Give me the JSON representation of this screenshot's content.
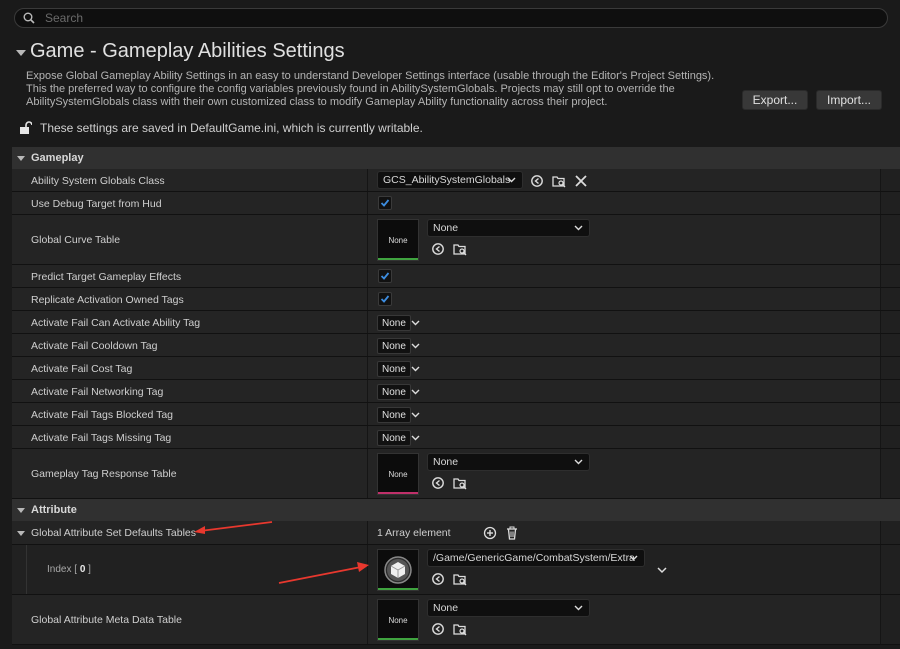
{
  "search": {
    "placeholder": "Search"
  },
  "header": {
    "title": "Game - Gameplay Abilities Settings",
    "description": [
      "Expose Global Gameplay Ability Settings in an easy to understand Developer Settings interface (usable through the Editor's Project Settings).",
      "This the preferred way to configure the config variables previously found in AbilitySystemGlobals.  Projects may still opt to override the",
      "AbilitySystemGlobals class with their own customized class to modify Gameplay Ability functionality across their project."
    ],
    "export_label": "Export...",
    "import_label": "Import...",
    "writable_text": "These settings are saved in DefaultGame.ini, which is currently writable."
  },
  "categories": {
    "gameplay": "Gameplay",
    "attribute": "Attribute"
  },
  "gameplay": {
    "ability_system_globals_class": {
      "label": "Ability System Globals Class",
      "value": "GCS_AbilitySystemGlobals"
    },
    "use_debug_target": {
      "label": "Use Debug Target from Hud",
      "checked": true
    },
    "global_curve_table": {
      "label": "Global Curve Table",
      "thumb": "None",
      "value": "None"
    },
    "predict_target_effects": {
      "label": "Predict Target Gameplay Effects",
      "checked": true
    },
    "replicate_activation_tags": {
      "label": "Replicate Activation Owned Tags",
      "checked": true
    },
    "fail_can_activate": {
      "label": "Activate Fail Can Activate Ability Tag",
      "value": "None"
    },
    "fail_cooldown": {
      "label": "Activate Fail Cooldown Tag",
      "value": "None"
    },
    "fail_cost": {
      "label": "Activate Fail Cost Tag",
      "value": "None"
    },
    "fail_networking": {
      "label": "Activate Fail Networking Tag",
      "value": "None"
    },
    "fail_tags_blocked": {
      "label": "Activate Fail Tags Blocked Tag",
      "value": "None"
    },
    "fail_tags_missing": {
      "label": "Activate Fail Tags Missing Tag",
      "value": "None"
    },
    "tag_response_table": {
      "label": "Gameplay Tag Response Table",
      "thumb": "None",
      "value": "None"
    }
  },
  "attribute": {
    "defaults_tables": {
      "label": "Global Attribute Set Defaults Tables",
      "count": "1 Array element"
    },
    "index0": {
      "label_prefix": "Index [ ",
      "label_index": "0",
      "label_suffix": " ]",
      "value": "/Game/GenericGame/CombatSystem/Extra"
    },
    "meta_data_table": {
      "label": "Global Attribute Meta Data Table",
      "thumb": "None",
      "value": "None"
    }
  },
  "colors": {
    "curve_table_bar": "#3fa33f",
    "tag_response_bar": "#c0306a",
    "meta_table_bar": "#3fa33f",
    "annotation_arrow": "#e8382e",
    "checkmark": "#3d8de0"
  }
}
